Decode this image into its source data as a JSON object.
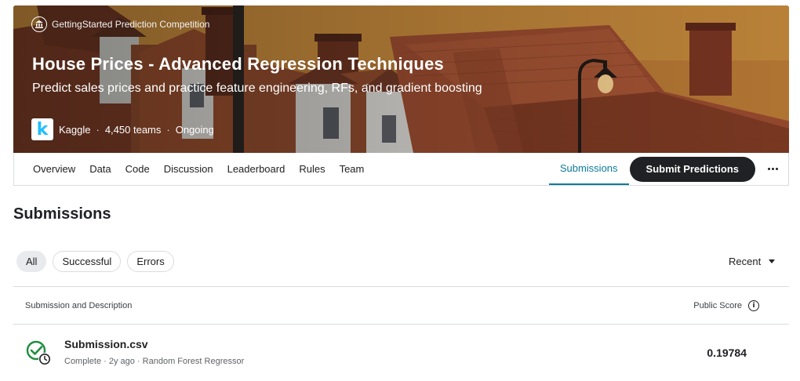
{
  "competition": {
    "type_label": "GettingStarted Prediction Competition",
    "type_icon": "institution-icon",
    "title": "House Prices - Advanced Regression Techniques",
    "subtitle": "Predict sales prices and practice feature engineering, RFs, and gradient boosting",
    "host": "Kaggle",
    "host_logo_letter": "k",
    "teams": "4,450 teams",
    "status": "Ongoing",
    "separator": "·"
  },
  "nav": {
    "tabs": [
      "Overview",
      "Data",
      "Code",
      "Discussion",
      "Leaderboard",
      "Rules",
      "Team"
    ],
    "active_tab": "Submissions",
    "submit_label": "Submit Predictions",
    "more_icon": "more-horizontal-icon"
  },
  "page": {
    "title": "Submissions"
  },
  "filters": {
    "chips": [
      "All",
      "Successful",
      "Errors"
    ],
    "selected": "All",
    "sort_label": "Recent"
  },
  "table": {
    "col_submission": "Submission and Description",
    "col_score": "Public Score",
    "rows": [
      {
        "filename": "Submission.csv",
        "status": "Complete",
        "age": "2y ago",
        "description": "Random Forest Regressor",
        "desc_line": "Complete · 2y ago · Random Forest Regressor",
        "score": "0.19784"
      }
    ]
  },
  "colors": {
    "accent": "#0e7c9b",
    "button_dark": "#202124",
    "success_green": "#1e8e3e",
    "kaggle_blue": "#20beff"
  }
}
